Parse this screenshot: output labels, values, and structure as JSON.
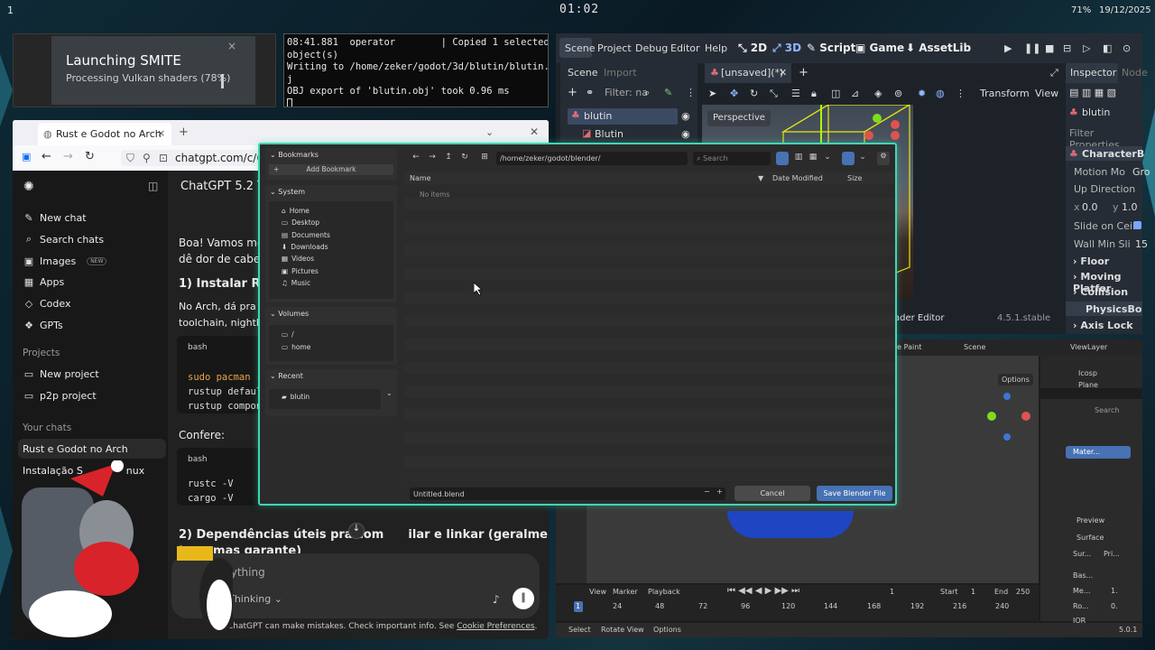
{
  "topbar": {
    "workspace": "1",
    "clock": "01:02",
    "battery": "71%",
    "date": "19/12/2025"
  },
  "notification": {
    "title": "Launching SMITE",
    "subtitle": "Processing Vulkan shaders (78%)",
    "close": "×"
  },
  "terminal": {
    "lines": [
      "08:41.881  operator        | Copied 1 selected",
      "object(s)",
      "Writing to /home/zeker/godot/3d/blutin/blutin.ob",
      "j",
      "OBJ export of 'blutin.obj' took 0.96 ms"
    ]
  },
  "browser": {
    "tab_title": "Rust e Godot no Arch",
    "tab_close": "×",
    "new_tab": "+",
    "url": "chatgpt.com/c/694",
    "sidebar": {
      "items": [
        {
          "icon": "✎",
          "label": "New chat"
        },
        {
          "icon": "⌕",
          "label": "Search chats"
        },
        {
          "icon": "▣",
          "label": "Images"
        },
        {
          "icon": "▦",
          "label": "Apps"
        },
        {
          "icon": "◇",
          "label": "Codex"
        },
        {
          "icon": "❖",
          "label": "GPTs"
        }
      ],
      "new_badge": "NEW",
      "projects_heading": "Projects",
      "projects": [
        "New project",
        "p2p project"
      ],
      "chats_heading": "Your chats",
      "chats": [
        "Rust e Godot no Arch",
        "Instalação S",
        "nux"
      ]
    },
    "main": {
      "model": "ChatGPT 5.2 Th",
      "p1a": "Boa! Vamos mont",
      "p1b": "dê dor de cabeça",
      "h1": "1) Instalar Rus",
      "p2a": "No Arch, dá pra i",
      "p2b": "toolchain, nightly",
      "code1_label": "bash",
      "code1_l1": "sudo pacman -S",
      "code1_l2": "rustup default",
      "code1_l3": "rustup compone",
      "confere": "Confere:",
      "code2_label": "bash",
      "code2_l1": "rustc -V",
      "code2_l2": "cargo -V",
      "h2": "2) Dependências úteis pra com      ilar e linkar (geralmente já",
      "h2b": "tem, mas garante)",
      "input_placeholder": "k anything",
      "thinking": "Thinking",
      "disclaimer": "ChatGPT can make mistakes. Check important info. See ",
      "cookie_link": "Cookie Preferences",
      "disclaimer_end": "."
    }
  },
  "godot": {
    "menu": [
      "Scene",
      "Project",
      "Debug",
      "Editor",
      "Help"
    ],
    "modes": [
      "2D",
      "3D",
      "Script",
      "Game",
      "AssetLib"
    ],
    "scene_tabs": [
      "Scene",
      "Import"
    ],
    "filter": "Filter: na",
    "tree": [
      "blutin",
      "Blutin"
    ],
    "editor_tab": "[unsaved](*)",
    "perspective": "Perspective",
    "transform": "Transform",
    "view": "View",
    "shader_editor": "ader Editor",
    "version": "4.5.1.stable",
    "inspector_tabs": [
      "Inspector",
      "Node"
    ],
    "inspector_node": "blutin",
    "filter_props": "Filter Properties",
    "class": "CharacterB",
    "props": [
      "Motion Mo",
      "Up Direction",
      "Slide on Ceil",
      "Wall Min Sli"
    ],
    "motion_value": "Gro",
    "x": "0.0",
    "y": "1.0",
    "wall_value": "15",
    "sections": [
      "Floor",
      "Moving Platfor",
      "Collision"
    ],
    "physics": "PhysicsBo",
    "axis_lock": "Axis Lock"
  },
  "blender": {
    "header": [
      "ure Paint",
      "Scene",
      "ViewLayer"
    ],
    "outliner": [
      "Icosp",
      "Plane"
    ],
    "options": "Options",
    "search": "Search",
    "material": "Mater...",
    "preview": "Preview",
    "surface": "Surface",
    "props": [
      "Sur...",
      "Pri...",
      "Bas...",
      "Me...",
      "Ro...",
      "IOR"
    ],
    "prop_values": [
      "1.",
      "0.",
      "1."
    ],
    "timeline_menu": [
      "View",
      "Marker",
      "Playback"
    ],
    "frame": "1",
    "start_label": "Start",
    "start": "1",
    "end_label": "End",
    "end": "250",
    "ruler": [
      "1",
      "24",
      "48",
      "72",
      "96",
      "120",
      "144",
      "168",
      "192",
      "216",
      "240"
    ],
    "status": [
      "Select",
      "Rotate View",
      "Options"
    ],
    "version": "5.0.1"
  },
  "dialog": {
    "bookmarks": "Bookmarks",
    "add_bookmark": "Add Bookmark",
    "system": "System",
    "system_items": [
      "Home",
      "Desktop",
      "Documents",
      "Downloads",
      "Videos",
      "Pictures",
      "Music"
    ],
    "volumes": "Volumes",
    "volume_items": [
      "/",
      "home"
    ],
    "recent": "Recent",
    "recent_items": [
      "blutin"
    ],
    "path": "/home/zeker/godot/blender/",
    "search_placeholder": "Search",
    "col_name": "Name",
    "col_date": "Date Modified",
    "col_size": "Size",
    "empty": "No items",
    "filename": "Untitled.blend",
    "cancel": "Cancel",
    "save": "Save Blender File",
    "accent": "#4772b3",
    "border": "#3fd7b5"
  }
}
